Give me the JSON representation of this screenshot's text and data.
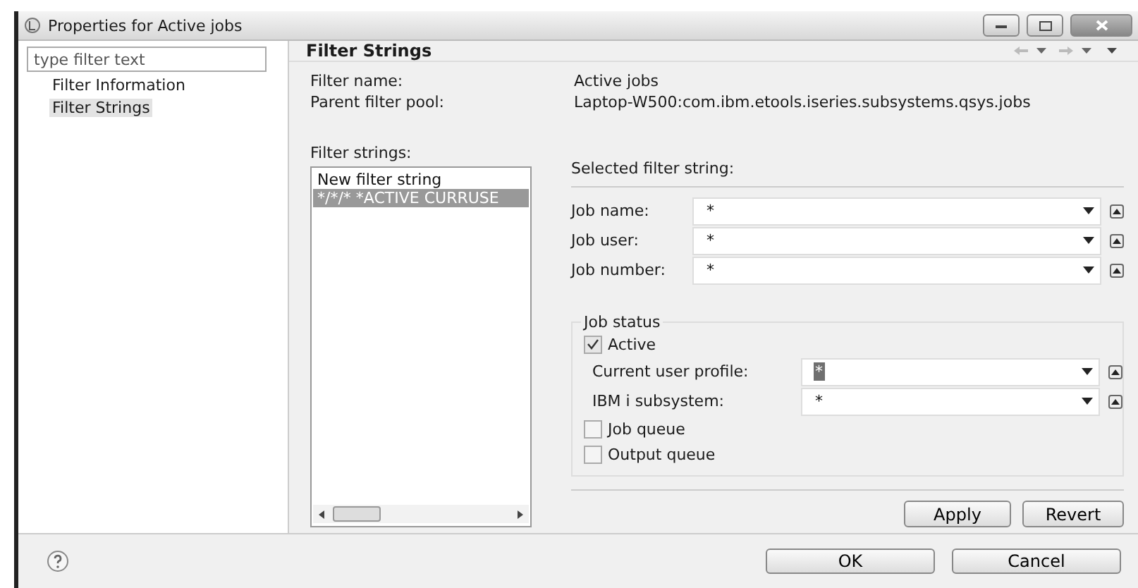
{
  "window": {
    "title": "Properties for Active jobs"
  },
  "sidebar": {
    "search": {
      "placeholder": "type filter text"
    },
    "items": [
      {
        "label": "Filter Information",
        "selected": false
      },
      {
        "label": "Filter Strings",
        "selected": true
      }
    ]
  },
  "page": {
    "title": "Filter Strings",
    "info": [
      {
        "label": "Filter name:",
        "value": "Active jobs"
      },
      {
        "label": "Parent filter pool:",
        "value": "Laptop-W500:com.ibm.etools.iseries.subsystems.qsys.jobs"
      }
    ],
    "filter_strings": {
      "label": "Filter strings:",
      "items": [
        {
          "text": "New filter string",
          "selected": false
        },
        {
          "text": "*/*/* *ACTIVE CURRUSE",
          "selected": true
        }
      ]
    },
    "selected_filter": {
      "label": "Selected filter string:",
      "fields": [
        {
          "label": "Job name:",
          "value": "*",
          "highlighted": false
        },
        {
          "label": "Job user:",
          "value": "*",
          "highlighted": false
        },
        {
          "label": "Job number:",
          "value": "*",
          "highlighted": false
        }
      ]
    },
    "job_status": {
      "title": "Job status",
      "items": [
        {
          "kind": "checkbox",
          "label": "Active",
          "checked": true
        },
        {
          "kind": "combo",
          "label": "Current user profile:",
          "value": "*",
          "highlighted": true
        },
        {
          "kind": "combo",
          "label": "IBM i subsystem:",
          "value": "*",
          "highlighted": false
        },
        {
          "kind": "checkbox",
          "label": "Job queue",
          "checked": false
        },
        {
          "kind": "checkbox",
          "label": "Output queue",
          "checked": false
        }
      ]
    },
    "buttons": [
      "Apply",
      "Revert"
    ]
  },
  "footer": {
    "buttons": [
      "OK",
      "Cancel"
    ]
  }
}
